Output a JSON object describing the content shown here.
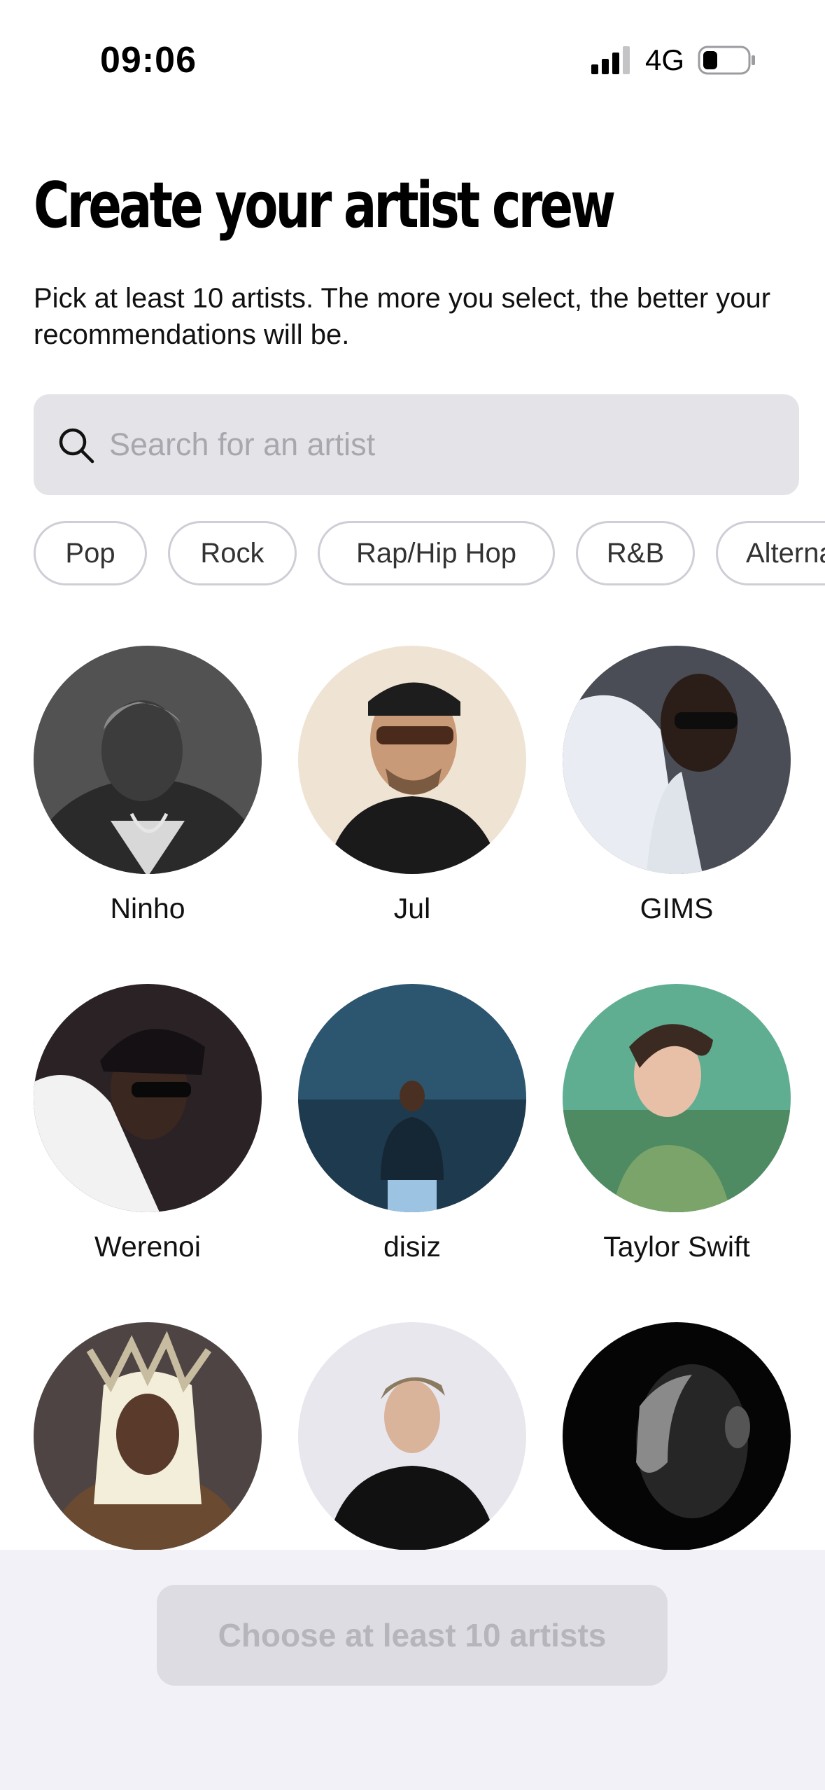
{
  "status_bar": {
    "time": "09:06",
    "network": "4G",
    "signal_icon": "signal-bars-icon",
    "battery_icon": "battery-low-icon"
  },
  "header": {
    "title": "Create your artist crew",
    "subtitle": "Pick at least 10 artists. The more you select, the better your recommendations will be."
  },
  "search": {
    "placeholder": "Search for an artist",
    "value": "",
    "icon": "search-icon"
  },
  "genres": [
    {
      "label": "Pop"
    },
    {
      "label": "Rock"
    },
    {
      "label": "Rap/Hip Hop"
    },
    {
      "label": "R&B"
    },
    {
      "label": "Alternative"
    }
  ],
  "artists": [
    {
      "name": "Ninho"
    },
    {
      "name": "Jul"
    },
    {
      "name": "GIMS"
    },
    {
      "name": "Werenoi"
    },
    {
      "name": "disiz"
    },
    {
      "name": "Taylor Swift"
    },
    {
      "name": ""
    },
    {
      "name": ""
    },
    {
      "name": ""
    }
  ],
  "footer": {
    "cta_label": "Choose at least 10 artists",
    "cta_enabled": false
  },
  "colors": {
    "search_bg": "#e4e3e8",
    "chip_border": "#cfcdd6",
    "footer_bg": "#f2f1f7",
    "cta_disabled_bg": "#dddce2",
    "cta_disabled_text": "#b6b5bb"
  }
}
